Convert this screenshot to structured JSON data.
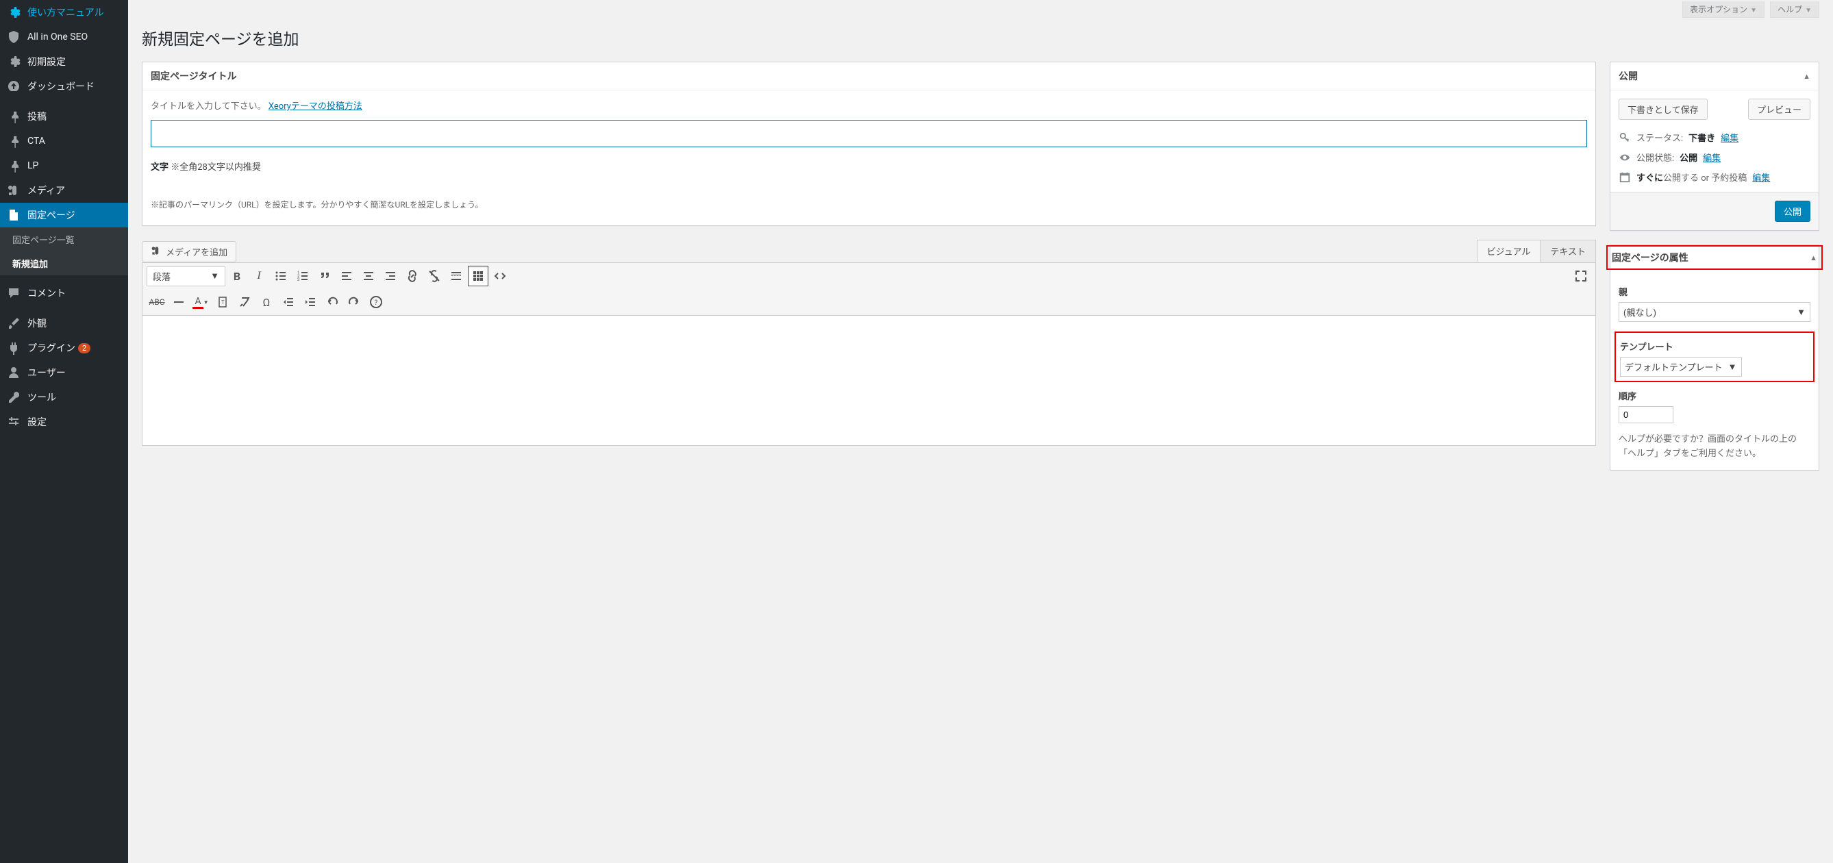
{
  "top_tabs": {
    "options": "表示オプション",
    "help": "ヘルプ"
  },
  "page_title": "新規固定ページを追加",
  "sidebar": {
    "items": [
      {
        "label": "使い方マニュアル",
        "icon": "gear",
        "highlight": true
      },
      {
        "label": "All in One SEO",
        "icon": "shield"
      },
      {
        "label": "初期設定",
        "icon": "gear"
      },
      {
        "label": "ダッシュボード",
        "icon": "dashboard"
      },
      {
        "label": "投稿",
        "icon": "pin"
      },
      {
        "label": "CTA",
        "icon": "pin"
      },
      {
        "label": "LP",
        "icon": "pin"
      },
      {
        "label": "メディア",
        "icon": "media"
      },
      {
        "label": "固定ページ",
        "icon": "page",
        "current": true
      },
      {
        "label": "コメント",
        "icon": "comment"
      },
      {
        "label": "外観",
        "icon": "brush"
      },
      {
        "label": "プラグイン",
        "icon": "plugin",
        "badge": "2"
      },
      {
        "label": "ユーザー",
        "icon": "user"
      },
      {
        "label": "ツール",
        "icon": "wrench"
      },
      {
        "label": "設定",
        "icon": "sliders"
      }
    ],
    "submenu": [
      {
        "label": "固定ページ一覧"
      },
      {
        "label": "新規追加",
        "active": true
      }
    ]
  },
  "titlebox": {
    "heading": "固定ページタイトル",
    "desc_text": "タイトルを入力して下さい。",
    "desc_link": "Xeoryテーマの投稿方法",
    "value": "",
    "char_label": "文字",
    "char_note": "※全角28文字以内推奨",
    "permalink_note": "※記事のパーマリンク（URL）を設定します。分かりやすく簡潔なURLを設定しましょう。"
  },
  "editor": {
    "add_media": "メディアを追加",
    "tab_visual": "ビジュアル",
    "tab_text": "テキスト",
    "format_select": "段落"
  },
  "publish": {
    "heading": "公開",
    "save_draft": "下書きとして保存",
    "preview": "プレビュー",
    "status_label": "ステータス:",
    "status_value": "下書き",
    "visibility_label": "公開状態:",
    "visibility_value": "公開",
    "schedule_bold": "すぐに",
    "schedule_rest": "公開する or 予約投稿",
    "edit_link": "編集",
    "publish_btn": "公開"
  },
  "attrs": {
    "heading": "固定ページの属性",
    "parent_label": "親",
    "parent_value": "(親なし)",
    "template_label": "テンプレート",
    "template_value": "デフォルトテンプレート",
    "order_label": "順序",
    "order_value": "0",
    "help": "ヘルプが必要ですか？画面のタイトルの上の「ヘルプ」タブをご利用ください。"
  }
}
